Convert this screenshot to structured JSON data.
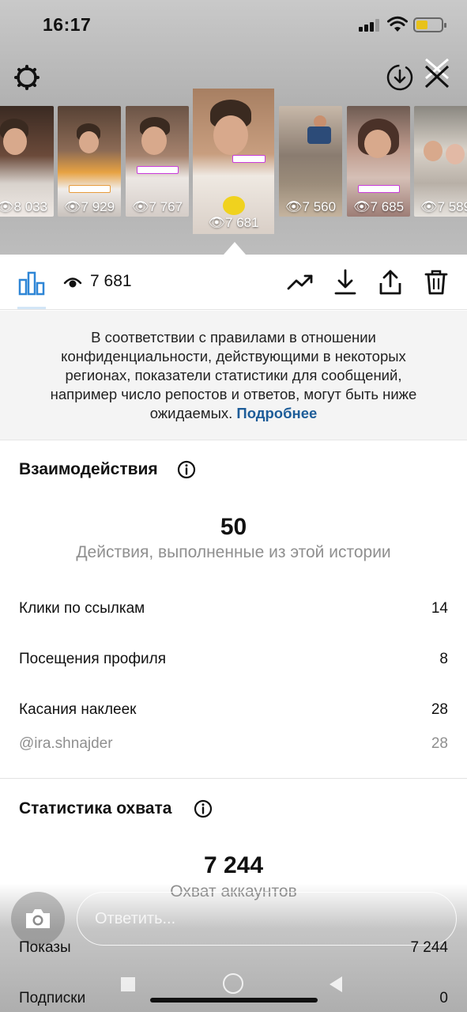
{
  "status_bar": {
    "time": "16:17"
  },
  "stories": [
    {
      "views": "8 033"
    },
    {
      "views": "7 929"
    },
    {
      "views": "7 767"
    },
    {
      "views": "7 681",
      "active": true
    },
    {
      "views": "7 560"
    },
    {
      "views": "7 685"
    },
    {
      "views": "7 589"
    }
  ],
  "toolbar": {
    "views": "7 681",
    "icons": [
      "bar-chart-icon",
      "eye-icon",
      "trending-icon",
      "download-icon",
      "share-icon",
      "trash-icon"
    ]
  },
  "notice": {
    "text": "В соответствии с правилами в отношении конфиденциальности, действующими в некоторых регионах, показатели статистики для сообщений, например число репостов и ответов, могут быть ниже ожидаемых.",
    "link": "Подробнее"
  },
  "interactions": {
    "title": "Взаимодействия",
    "total": "50",
    "total_label": "Действия, выполненные из этой истории",
    "rows": [
      {
        "label": "Клики по ссылкам",
        "value": "14"
      },
      {
        "label": "Посещения профиля",
        "value": "8"
      },
      {
        "label": "Касания наклеек",
        "value": "28"
      },
      {
        "label": "@ira.shnajder",
        "value": "28"
      }
    ]
  },
  "reach": {
    "title": "Статистика охвата",
    "total": "7 244",
    "total_label": "Охват аккаунтов",
    "rows": [
      {
        "label": "Показы",
        "value": "7 244"
      },
      {
        "label": "Подписки",
        "value": "0"
      }
    ]
  },
  "reply": {
    "placeholder": "Ответить..."
  },
  "colors": {
    "link": "#1d5c98",
    "accent_blue": "#2f86d6",
    "battery": "#e8c21a"
  }
}
